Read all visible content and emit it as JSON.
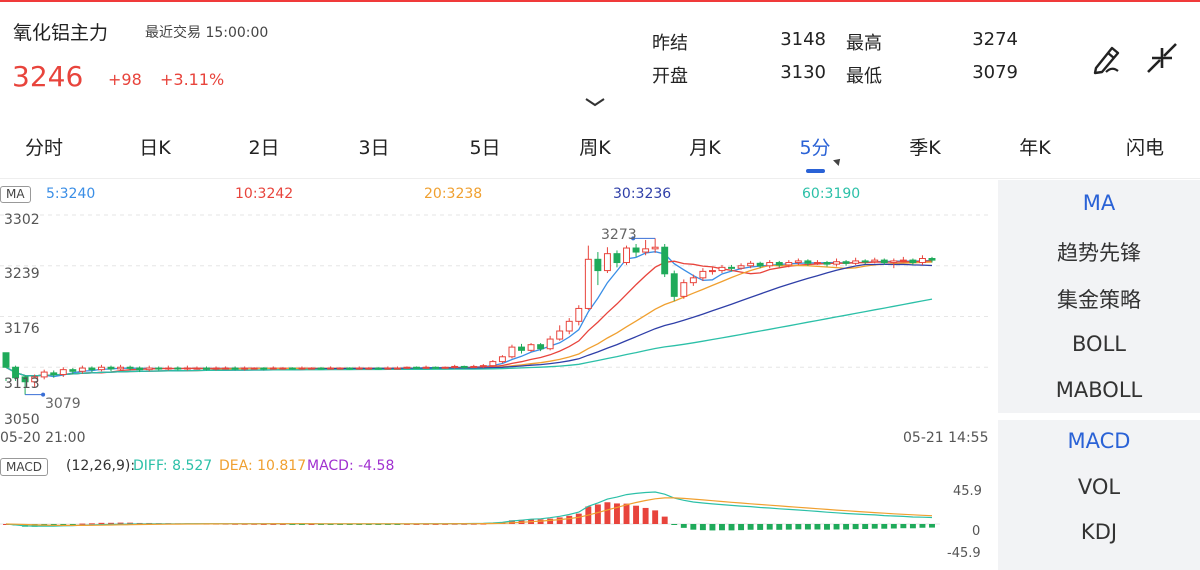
{
  "header": {
    "title": "氧化铝主力",
    "trade_label": "最近交易  15:00:00",
    "price": "3246",
    "change": "+98",
    "change_pct": "+3.11%",
    "stats": [
      {
        "label": "昨结",
        "value": "3148"
      },
      {
        "label": "最高",
        "value": "3274"
      },
      {
        "label": "开盘",
        "value": "3130"
      },
      {
        "label": "最低",
        "value": "3079"
      }
    ],
    "icons": [
      "draw-icon",
      "collapse-icon"
    ]
  },
  "tabs": [
    {
      "label": "分时",
      "active": false
    },
    {
      "label": "日K",
      "active": false
    },
    {
      "label": "2日",
      "active": false
    },
    {
      "label": "3日",
      "active": false
    },
    {
      "label": "5日",
      "active": false
    },
    {
      "label": "周K",
      "active": false
    },
    {
      "label": "月K",
      "active": false
    },
    {
      "label": "5分",
      "active": true
    },
    {
      "label": "季K",
      "active": false
    },
    {
      "label": "年K",
      "active": false
    },
    {
      "label": "闪电",
      "active": false
    }
  ],
  "ma": {
    "tag": "MA",
    "items": [
      {
        "label": "5:3240",
        "color": "#3a8ee6"
      },
      {
        "label": "10:3242",
        "color": "#e8443c"
      },
      {
        "label": "20:3238",
        "color": "#f0a030"
      },
      {
        "label": "30:3236",
        "color": "#2f3fa8"
      },
      {
        "label": "60:3190",
        "color": "#2cc0a8"
      }
    ]
  },
  "price_axis": [
    "3302",
    "3239",
    "3176",
    "3113",
    "3050"
  ],
  "time_axis": {
    "start": "05-20 21:00",
    "end": "05-21 14:55"
  },
  "annotations": {
    "high": "3273",
    "low": "3079"
  },
  "macd": {
    "tag": "MACD",
    "params": "(12,26,9):",
    "diff": "DIFF: 8.527",
    "dea": "DEA: 10.817",
    "macd": "MACD: -4.58",
    "axis_top": "45.9",
    "axis_mid": "0",
    "axis_bottom": "-45.9",
    "colors": {
      "diff": "#2cc0a8",
      "dea": "#f0a030",
      "macd": "#a030d0",
      "up": "#e8443c",
      "down": "#1faa5a"
    }
  },
  "side_panel": {
    "group1": [
      {
        "label": "MA",
        "active": true
      },
      {
        "label": "趋势先锋",
        "active": false
      },
      {
        "label": "集金策略",
        "active": false
      },
      {
        "label": "BOLL",
        "active": false
      },
      {
        "label": "MABOLL",
        "active": false
      }
    ],
    "group2": [
      {
        "label": "MACD",
        "active": true
      },
      {
        "label": "VOL",
        "active": false
      },
      {
        "label": "KDJ",
        "active": false
      }
    ]
  },
  "chart_data": {
    "type": "candlestick",
    "ylim": [
      3050,
      3302
    ],
    "candles": [
      [
        3131,
        3113,
        3096,
        3099
      ],
      [
        3113,
        3100,
        3096,
        3115
      ],
      [
        3101,
        3095,
        3079,
        3103
      ],
      [
        3095,
        3101,
        3088,
        3104
      ],
      [
        3101,
        3107,
        3098,
        3110
      ],
      [
        3106,
        3104,
        3100,
        3109
      ],
      [
        3104,
        3110,
        3101,
        3113
      ],
      [
        3110,
        3108,
        3104,
        3112
      ],
      [
        3108,
        3112,
        3105,
        3115
      ],
      [
        3112,
        3110,
        3107,
        3114
      ],
      [
        3110,
        3113,
        3108,
        3116
      ],
      [
        3113,
        3111,
        3108,
        3115
      ],
      [
        3111,
        3113,
        3109,
        3116
      ],
      [
        3113,
        3112,
        3109,
        3115
      ],
      [
        3112,
        3110,
        3107,
        3114
      ],
      [
        3110,
        3112,
        3108,
        3115
      ],
      [
        3112,
        3111,
        3109,
        3114
      ],
      [
        3111,
        3112,
        3109,
        3115
      ],
      [
        3112,
        3111,
        3109,
        3114
      ],
      [
        3111,
        3112,
        3109,
        3115
      ],
      [
        3112,
        3112,
        3110,
        3114
      ],
      [
        3112,
        3111,
        3109,
        3114
      ],
      [
        3111,
        3112,
        3109,
        3114
      ],
      [
        3112,
        3112,
        3110,
        3114
      ],
      [
        3112,
        3111,
        3109,
        3114
      ],
      [
        3111,
        3112,
        3109,
        3114
      ],
      [
        3112,
        3112,
        3110,
        3113
      ],
      [
        3112,
        3111,
        3109,
        3113
      ],
      [
        3111,
        3112,
        3110,
        3114
      ],
      [
        3112,
        3112,
        3110,
        3113
      ],
      [
        3112,
        3111,
        3110,
        3113
      ],
      [
        3111,
        3112,
        3110,
        3114
      ],
      [
        3112,
        3112,
        3110,
        3113
      ],
      [
        3112,
        3111,
        3110,
        3113
      ],
      [
        3111,
        3112,
        3110,
        3114
      ],
      [
        3112,
        3112,
        3110,
        3113
      ],
      [
        3112,
        3111,
        3110,
        3113
      ],
      [
        3111,
        3112,
        3110,
        3114
      ],
      [
        3112,
        3112,
        3110,
        3113
      ],
      [
        3112,
        3111,
        3110,
        3113
      ],
      [
        3111,
        3112,
        3110,
        3114
      ],
      [
        3112,
        3112,
        3111,
        3114
      ],
      [
        3112,
        3113,
        3111,
        3114
      ],
      [
        3113,
        3112,
        3111,
        3114
      ],
      [
        3112,
        3113,
        3111,
        3115
      ],
      [
        3113,
        3112,
        3111,
        3114
      ],
      [
        3112,
        3113,
        3111,
        3114
      ],
      [
        3113,
        3114,
        3111,
        3116
      ],
      [
        3114,
        3113,
        3111,
        3115
      ],
      [
        3113,
        3114,
        3112,
        3116
      ],
      [
        3114,
        3115,
        3112,
        3117
      ],
      [
        3115,
        3120,
        3113,
        3122
      ],
      [
        3120,
        3126,
        3118,
        3128
      ],
      [
        3126,
        3138,
        3124,
        3141
      ],
      [
        3138,
        3134,
        3130,
        3142
      ],
      [
        3134,
        3141,
        3132,
        3143
      ],
      [
        3141,
        3136,
        3133,
        3143
      ],
      [
        3136,
        3148,
        3134,
        3152
      ],
      [
        3148,
        3158,
        3146,
        3165
      ],
      [
        3158,
        3170,
        3154,
        3174
      ],
      [
        3170,
        3186,
        3165,
        3190
      ],
      [
        3186,
        3247,
        3184,
        3264
      ],
      [
        3247,
        3233,
        3215,
        3256
      ],
      [
        3233,
        3254,
        3230,
        3262
      ],
      [
        3254,
        3243,
        3237,
        3258
      ],
      [
        3243,
        3261,
        3240,
        3264
      ],
      [
        3261,
        3256,
        3250,
        3266
      ],
      [
        3256,
        3260,
        3252,
        3271
      ],
      [
        3260,
        3262,
        3255,
        3273
      ],
      [
        3262,
        3229,
        3225,
        3266
      ],
      [
        3229,
        3201,
        3195,
        3233
      ],
      [
        3201,
        3218,
        3198,
        3222
      ],
      [
        3218,
        3224,
        3214,
        3228
      ],
      [
        3224,
        3232,
        3220,
        3236
      ],
      [
        3232,
        3233,
        3228,
        3238
      ],
      [
        3233,
        3237,
        3230,
        3240
      ],
      [
        3237,
        3236,
        3232,
        3240
      ],
      [
        3236,
        3239,
        3234,
        3242
      ],
      [
        3239,
        3242,
        3236,
        3245
      ],
      [
        3242,
        3239,
        3236,
        3244
      ],
      [
        3239,
        3243,
        3236,
        3246
      ],
      [
        3243,
        3240,
        3237,
        3245
      ],
      [
        3240,
        3243,
        3237,
        3246
      ],
      [
        3243,
        3245,
        3240,
        3248
      ],
      [
        3245,
        3242,
        3239,
        3247
      ],
      [
        3242,
        3243,
        3240,
        3246
      ],
      [
        3243,
        3241,
        3238,
        3245
      ],
      [
        3241,
        3244,
        3238,
        3248
      ],
      [
        3244,
        3242,
        3239,
        3246
      ],
      [
        3242,
        3245,
        3240,
        3249
      ],
      [
        3245,
        3244,
        3241,
        3247
      ],
      [
        3244,
        3246,
        3242,
        3249
      ],
      [
        3246,
        3243,
        3240,
        3248
      ],
      [
        3243,
        3245,
        3236,
        3248
      ],
      [
        3245,
        3246,
        3243,
        3250
      ],
      [
        3246,
        3243,
        3240,
        3248
      ],
      [
        3243,
        3248,
        3240,
        3252
      ],
      [
        3248,
        3246,
        3243,
        3250
      ]
    ]
  }
}
